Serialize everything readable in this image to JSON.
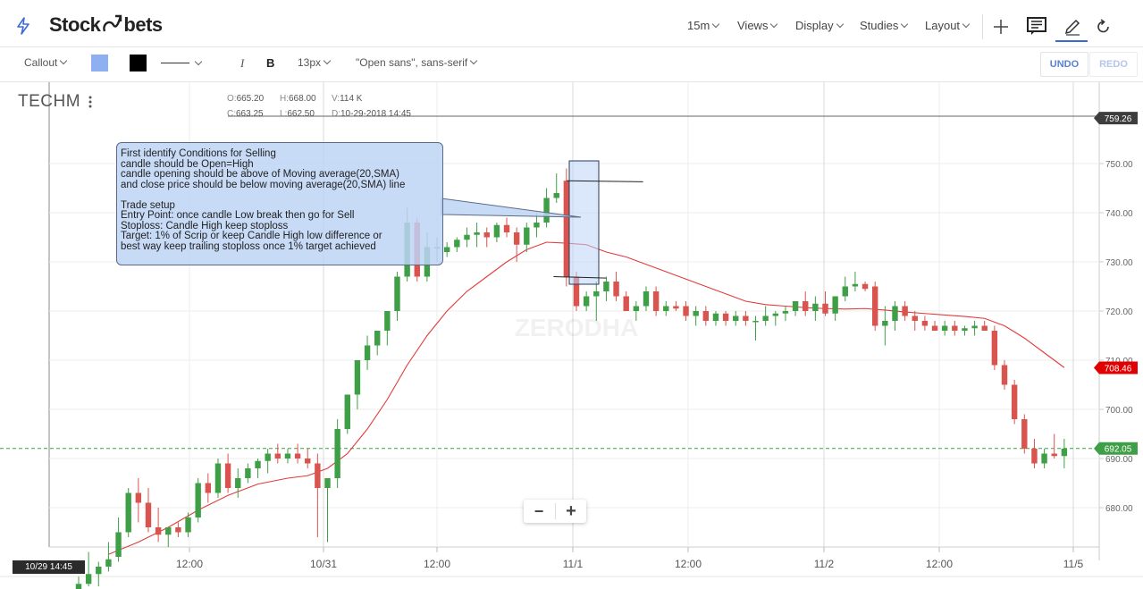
{
  "header": {
    "brand_left": "Stock",
    "brand_right": "bets",
    "menu": [
      {
        "label": "15m"
      },
      {
        "label": "Views"
      },
      {
        "label": "Display"
      },
      {
        "label": "Studies"
      },
      {
        "label": "Layout"
      }
    ]
  },
  "drawing_toolbar": {
    "tool_select": "Callout",
    "fill_color": "#8fb0f0",
    "line_color": "#000000",
    "italic_label": "I",
    "bold_label": "B",
    "font_size": "13px",
    "font_family": "\"Open sans\", sans-serif",
    "undo_label": "UNDO",
    "redo_label": "REDO"
  },
  "symbol": "TECHM",
  "ohlc": {
    "open_label": "O:",
    "open": "665.20",
    "high_label": "H:",
    "high": "668.00",
    "vol_label": "V:",
    "vol": "114 K",
    "close_label": "C:",
    "close": "663.25",
    "low_label": "L:",
    "low": "662.50",
    "date_label": "D:",
    "date": "10-29-2018 14:45"
  },
  "callout_text": "First identify Conditions for Selling\ncandle should be Open=High\ncandle opening should be above of Moving average(20,SMA)\nand close price should be below moving average(20,SMA) line\n\nTrade setup\nEntry Point: once candle Low break then go for Sell\nStoploss: Candle High keep stoploss\nTarget: 1% of Scrip or keep Candle High low difference or\nbest way keep trailing stoploss once 1% target achieved",
  "watermark": "ZERODHA",
  "zoom": {
    "minus": "−",
    "plus": "+"
  },
  "crosshair_date": "10/29 14:45",
  "price_tags": {
    "top": "759.26",
    "sma": "708.46",
    "last": "692.05"
  },
  "colors": {
    "up": "#3f9f46",
    "down": "#d9534f",
    "sma": "#e23b3b",
    "last_price": "#3f9f46",
    "accent": "#3b6bd6"
  },
  "chart_data": {
    "type": "candlestick",
    "symbol": "TECHM",
    "interval": "15m",
    "y_ticks": [
      680,
      690,
      700,
      710,
      720,
      730,
      740,
      750
    ],
    "ylim": [
      672,
      762
    ],
    "x_ticks": [
      "12:00",
      "10/31",
      "12:00",
      "11/1",
      "12:00",
      "11/2",
      "12:00",
      "11/5"
    ],
    "candles": [
      {
        "o": 663.3,
        "h": 666,
        "l": 660,
        "c": 664.5
      },
      {
        "o": 664.5,
        "h": 671,
        "l": 664,
        "c": 666.5
      },
      {
        "o": 666.5,
        "h": 669,
        "l": 664,
        "c": 668
      },
      {
        "o": 668,
        "h": 673,
        "l": 667,
        "c": 669.5
      },
      {
        "o": 670,
        "h": 678,
        "l": 669,
        "c": 675
      },
      {
        "o": 675,
        "h": 684,
        "l": 674,
        "c": 683
      },
      {
        "o": 683,
        "h": 686,
        "l": 677,
        "c": 681
      },
      {
        "o": 681,
        "h": 684,
        "l": 675,
        "c": 676
      },
      {
        "o": 676,
        "h": 680,
        "l": 673,
        "c": 674.5
      },
      {
        "o": 674.5,
        "h": 676,
        "l": 672,
        "c": 676
      },
      {
        "o": 676,
        "h": 677,
        "l": 674,
        "c": 675
      },
      {
        "o": 675,
        "h": 679,
        "l": 674,
        "c": 678
      },
      {
        "o": 678,
        "h": 686,
        "l": 677,
        "c": 685
      },
      {
        "o": 685,
        "h": 687,
        "l": 681,
        "c": 683
      },
      {
        "o": 683,
        "h": 690,
        "l": 682,
        "c": 689
      },
      {
        "o": 689,
        "h": 691,
        "l": 683,
        "c": 684
      },
      {
        "o": 684,
        "h": 688,
        "l": 682,
        "c": 686
      },
      {
        "o": 686,
        "h": 689,
        "l": 685,
        "c": 688
      },
      {
        "o": 688,
        "h": 690,
        "l": 686,
        "c": 689.5
      },
      {
        "o": 689.5,
        "h": 692,
        "l": 687,
        "c": 691
      },
      {
        "o": 691,
        "h": 693,
        "l": 689,
        "c": 690
      },
      {
        "o": 690,
        "h": 692,
        "l": 689,
        "c": 691
      },
      {
        "o": 691,
        "h": 693,
        "l": 689,
        "c": 690
      },
      {
        "o": 690,
        "h": 692,
        "l": 688,
        "c": 689
      },
      {
        "o": 689,
        "h": 691,
        "l": 674,
        "c": 684
      },
      {
        "o": 684,
        "h": 686,
        "l": 673,
        "c": 686
      },
      {
        "o": 686,
        "h": 698,
        "l": 684,
        "c": 696
      },
      {
        "o": 696,
        "h": 702,
        "l": 695,
        "c": 703
      },
      {
        "o": 703,
        "h": 708,
        "l": 700,
        "c": 710
      },
      {
        "o": 710,
        "h": 715,
        "l": 708,
        "c": 713
      },
      {
        "o": 713,
        "h": 716,
        "l": 711,
        "c": 716
      },
      {
        "o": 716,
        "h": 720,
        "l": 713,
        "c": 720
      },
      {
        "o": 720,
        "h": 728,
        "l": 718,
        "c": 727
      },
      {
        "o": 727,
        "h": 741,
        "l": 726,
        "c": 738
      },
      {
        "o": 738,
        "h": 739,
        "l": 726,
        "c": 727
      },
      {
        "o": 727,
        "h": 736,
        "l": 726,
        "c": 733
      },
      {
        "o": 733,
        "h": 735,
        "l": 730,
        "c": 733
      },
      {
        "o": 732,
        "h": 734,
        "l": 731,
        "c": 733
      },
      {
        "o": 733,
        "h": 735,
        "l": 732,
        "c": 734.5
      },
      {
        "o": 734.5,
        "h": 737,
        "l": 733,
        "c": 735.5
      },
      {
        "o": 735.5,
        "h": 738,
        "l": 733,
        "c": 736
      },
      {
        "o": 736,
        "h": 737,
        "l": 733,
        "c": 735
      },
      {
        "o": 735,
        "h": 738,
        "l": 734,
        "c": 737.5
      },
      {
        "o": 737.5,
        "h": 739,
        "l": 735,
        "c": 736
      },
      {
        "o": 736,
        "h": 737,
        "l": 730,
        "c": 733.5
      },
      {
        "o": 733.5,
        "h": 738,
        "l": 732,
        "c": 737
      },
      {
        "o": 737,
        "h": 740,
        "l": 735,
        "c": 738
      },
      {
        "o": 738,
        "h": 745,
        "l": 737,
        "c": 743
      },
      {
        "o": 743,
        "h": 748,
        "l": 742,
        "c": 744
      },
      {
        "o": 746.5,
        "h": 749,
        "l": 725,
        "c": 727
      },
      {
        "o": 727,
        "h": 728,
        "l": 720,
        "c": 721
      },
      {
        "o": 721,
        "h": 724,
        "l": 720,
        "c": 723
      },
      {
        "o": 723,
        "h": 726,
        "l": 718,
        "c": 724
      },
      {
        "o": 724,
        "h": 727,
        "l": 722,
        "c": 726
      },
      {
        "o": 726,
        "h": 728,
        "l": 722,
        "c": 723
      },
      {
        "o": 723,
        "h": 724,
        "l": 720,
        "c": 720
      },
      {
        "o": 720,
        "h": 722,
        "l": 718,
        "c": 721
      },
      {
        "o": 721,
        "h": 725,
        "l": 720,
        "c": 724
      },
      {
        "o": 724,
        "h": 725,
        "l": 719,
        "c": 720
      },
      {
        "o": 720,
        "h": 722,
        "l": 719,
        "c": 721
      },
      {
        "o": 721,
        "h": 722,
        "l": 720,
        "c": 720.5
      },
      {
        "o": 721,
        "h": 722,
        "l": 718,
        "c": 719
      },
      {
        "o": 719,
        "h": 721,
        "l": 717,
        "c": 720
      },
      {
        "o": 720,
        "h": 721,
        "l": 717,
        "c": 718
      },
      {
        "o": 718,
        "h": 720,
        "l": 717,
        "c": 719.5
      },
      {
        "o": 719.5,
        "h": 720,
        "l": 717,
        "c": 718
      },
      {
        "o": 718,
        "h": 720,
        "l": 717,
        "c": 719
      },
      {
        "o": 719,
        "h": 720,
        "l": 717,
        "c": 718
      },
      {
        "o": 718,
        "h": 719,
        "l": 714,
        "c": 718
      },
      {
        "o": 718,
        "h": 721,
        "l": 717,
        "c": 719
      },
      {
        "o": 719,
        "h": 720,
        "l": 717,
        "c": 719.5
      },
      {
        "o": 719.5,
        "h": 721,
        "l": 718,
        "c": 720
      },
      {
        "o": 720,
        "h": 722,
        "l": 719,
        "c": 722
      },
      {
        "o": 722,
        "h": 724,
        "l": 719,
        "c": 720
      },
      {
        "o": 720,
        "h": 723,
        "l": 718,
        "c": 721.5
      },
      {
        "o": 721.5,
        "h": 724,
        "l": 719,
        "c": 719.5
      },
      {
        "o": 719.5,
        "h": 723,
        "l": 718,
        "c": 723
      },
      {
        "o": 723,
        "h": 727,
        "l": 722,
        "c": 725
      },
      {
        "o": 725,
        "h": 728,
        "l": 724,
        "c": 725.5
      },
      {
        "o": 725.5,
        "h": 726,
        "l": 724,
        "c": 724.5
      },
      {
        "o": 725,
        "h": 726,
        "l": 716,
        "c": 717
      },
      {
        "o": 717,
        "h": 721,
        "l": 713,
        "c": 718
      },
      {
        "o": 718,
        "h": 722,
        "l": 716,
        "c": 721
      },
      {
        "o": 721,
        "h": 722,
        "l": 718,
        "c": 719
      },
      {
        "o": 719,
        "h": 720,
        "l": 716,
        "c": 718
      },
      {
        "o": 718,
        "h": 719,
        "l": 716,
        "c": 717
      },
      {
        "o": 717,
        "h": 718,
        "l": 716,
        "c": 716
      },
      {
        "o": 716,
        "h": 718,
        "l": 715,
        "c": 717
      },
      {
        "o": 717,
        "h": 718,
        "l": 715,
        "c": 716
      },
      {
        "o": 716,
        "h": 717,
        "l": 715,
        "c": 716.5
      },
      {
        "o": 716.5,
        "h": 718,
        "l": 715,
        "c": 717
      },
      {
        "o": 717,
        "h": 718,
        "l": 716,
        "c": 716
      },
      {
        "o": 716,
        "h": 717,
        "l": 708,
        "c": 709
      },
      {
        "o": 709,
        "h": 710,
        "l": 704,
        "c": 705
      },
      {
        "o": 705,
        "h": 706,
        "l": 697,
        "c": 698
      },
      {
        "o": 698,
        "h": 699,
        "l": 691,
        "c": 692
      },
      {
        "o": 692,
        "h": 694,
        "l": 688,
        "c": 689
      },
      {
        "o": 689,
        "h": 692,
        "l": 688,
        "c": 691
      },
      {
        "o": 691,
        "h": 695,
        "l": 690,
        "c": 690.5
      },
      {
        "o": 690.5,
        "h": 694,
        "l": 688,
        "c": 692
      }
    ],
    "sma20": [
      [
        3,
        670.5
      ],
      [
        6,
        673
      ],
      [
        9,
        676
      ],
      [
        12,
        679.5
      ],
      [
        15,
        682.5
      ],
      [
        18,
        684.8
      ],
      [
        21,
        686
      ],
      [
        23,
        686.5
      ],
      [
        25,
        688
      ],
      [
        27,
        691
      ],
      [
        29,
        696
      ],
      [
        31,
        702
      ],
      [
        33,
        709
      ],
      [
        35,
        715
      ],
      [
        37,
        720
      ],
      [
        39,
        724
      ],
      [
        41,
        727
      ],
      [
        43,
        730
      ],
      [
        45,
        732.5
      ],
      [
        47,
        734
      ],
      [
        49,
        733.8
      ],
      [
        51,
        733.5
      ],
      [
        53,
        732
      ],
      [
        55,
        731
      ],
      [
        57,
        729.5
      ],
      [
        59,
        728
      ],
      [
        61,
        726.5
      ],
      [
        63,
        725
      ],
      [
        65,
        723.5
      ],
      [
        67,
        722
      ],
      [
        69,
        721.3
      ],
      [
        71,
        721
      ],
      [
        73,
        720.7
      ],
      [
        75,
        720.5
      ],
      [
        77,
        720.4
      ],
      [
        79,
        720.5
      ],
      [
        81,
        720.2
      ],
      [
        83,
        719.8
      ],
      [
        85,
        719.5
      ],
      [
        87,
        719.2
      ],
      [
        89,
        718.9
      ],
      [
        91,
        718.5
      ],
      [
        93,
        717
      ],
      [
        95,
        714.5
      ],
      [
        97,
        711.5
      ],
      [
        99,
        708.5
      ]
    ],
    "annotation_lines": [
      {
        "x1": 49.0,
        "y1": 746.5,
        "x2": 56.7,
        "y2": 746.3
      },
      {
        "x1": 47.7,
        "y1": 727,
        "x2": 53.0,
        "y2": 726.7
      }
    ]
  }
}
